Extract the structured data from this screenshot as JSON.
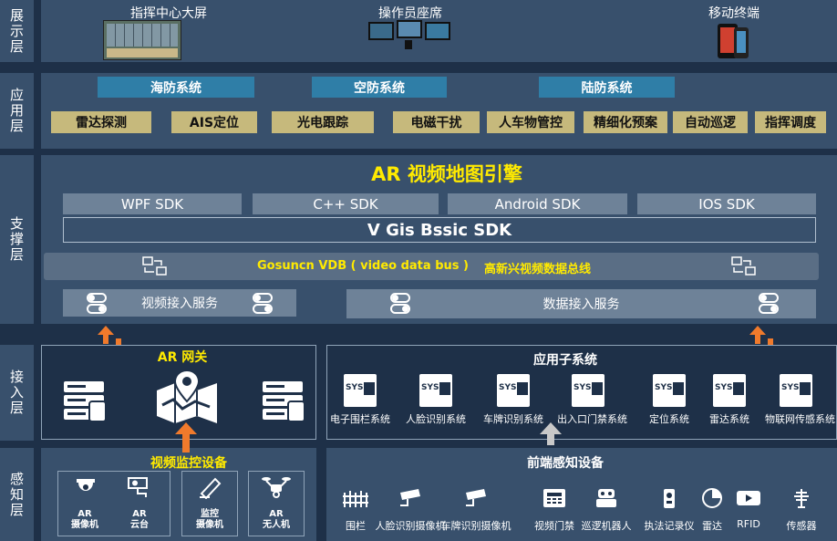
{
  "layers": {
    "display": "展示层",
    "application": "应用层",
    "support": "支撑层",
    "access": "接入层",
    "perception": "感知层"
  },
  "display": {
    "command_center": "指挥中心大屏",
    "operator_seat": "操作员座席",
    "mobile_terminal": "移动终端"
  },
  "app_systems": [
    "海防系统",
    "空防系统",
    "陆防系统"
  ],
  "app_functions": [
    "雷达探测",
    "AIS定位",
    "光电跟踪",
    "电磁干扰",
    "人车物管控",
    "精细化预案",
    "自动巡逻",
    "指挥调度"
  ],
  "support": {
    "engine_title": "AR 视频地图引擎",
    "sdks": [
      "WPF SDK",
      "C++ SDK",
      "Android SDK",
      "IOS SDK"
    ],
    "gis_sdk": "V Gis Bssic SDK",
    "bus_name": "Gosuncn VDB ( video data bus )",
    "bus_cn": "高新兴视频数据总线",
    "video_service": "视频接入服务",
    "data_service": "数据接入服务"
  },
  "access": {
    "gateway_title": "AR 网关",
    "subsystem_title": "应用子系统",
    "sys_badge": "SYS",
    "subsystems": [
      "电子围栏系统",
      "人脸识别系统",
      "车牌识别系统",
      "出入口门禁系统",
      "定位系统",
      "雷达系统",
      "物联网传感系统"
    ]
  },
  "perception": {
    "video_title": "视频监控设备",
    "front_title": "前端感知设备",
    "video_devices": [
      {
        "name": "ar-camera",
        "label1": "AR",
        "label2": "摄像机"
      },
      {
        "name": "ar-ptz",
        "label1": "AR",
        "label2": "云台"
      },
      {
        "name": "monitor-camera",
        "label1": "监控",
        "label2": "摄像机"
      },
      {
        "name": "ar-drone",
        "label1": "AR",
        "label2": "无人机"
      }
    ],
    "front_devices": [
      "围栏",
      "人脸识别摄像机",
      "车牌识别摄像机",
      "视频门禁",
      "巡逻机器人",
      "执法记录仪",
      "雷达",
      "RFID",
      "传感器"
    ]
  },
  "colors": {
    "background": "#1e3048",
    "layer": "#38506c",
    "system_tab": "#2f7ea7",
    "function_tag": "#c6b97c",
    "highlight_yellow": "#ffea00",
    "arrow_orange": "#f07a2c"
  }
}
